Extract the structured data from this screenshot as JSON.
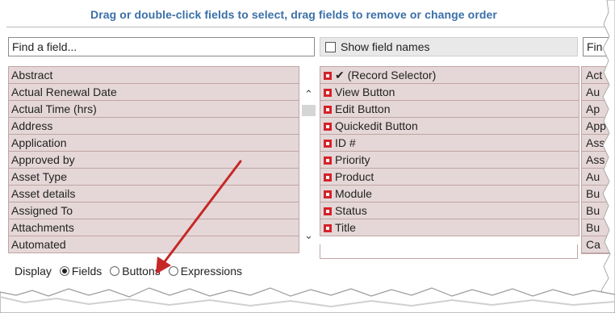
{
  "header": {
    "title": "Drag or double-click fields to select, drag fields to remove or change order"
  },
  "search_left": {
    "placeholder": "Find a field..."
  },
  "show_field_names": {
    "label": "Show field names",
    "checked": false
  },
  "search_right": {
    "placeholder": "Fin"
  },
  "available_fields": [
    "Abstract",
    "Actual Renewal Date",
    "Actual Time (hrs)",
    "Address",
    "Application",
    "Approved by",
    "Asset Type",
    "Asset details",
    "Assigned To",
    "Attachments",
    "Automated"
  ],
  "selected_fields": [
    "✔ (Record Selector)",
    "View Button",
    "Edit Button",
    "Quickedit Button",
    "ID #",
    "Priority",
    "Product",
    "Module",
    "Status",
    "Title"
  ],
  "right_fields": [
    "Act",
    "Au",
    "Ap",
    "App",
    "Ass",
    "Ass",
    "Au",
    "Bu",
    "Bu",
    "Bu",
    "Ca"
  ],
  "display": {
    "label": "Display",
    "options": [
      {
        "label": "Fields",
        "selected": true
      },
      {
        "label": "Buttons",
        "selected": false
      },
      {
        "label": "Expressions",
        "selected": false
      }
    ]
  },
  "colors": {
    "accent": "#3a6fa8",
    "row_bg": "#e5d7d7",
    "remove_icon": "#d4222a",
    "arrow": "#c62828"
  }
}
